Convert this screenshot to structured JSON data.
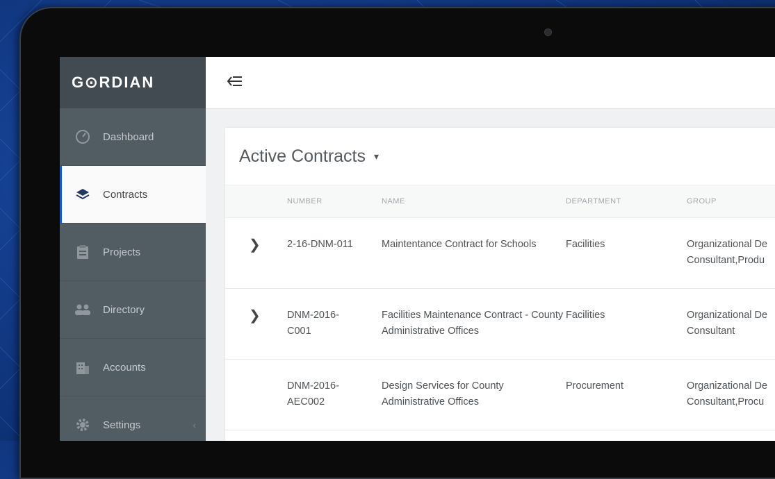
{
  "app": {
    "logo": "G⊙RDIAN"
  },
  "sidebar": {
    "items": [
      {
        "label": "Dashboard",
        "icon": "gauge-icon"
      },
      {
        "label": "Contracts",
        "icon": "layers-icon",
        "active": true
      },
      {
        "label": "Projects",
        "icon": "clipboard-icon"
      },
      {
        "label": "Directory",
        "icon": "people-icon"
      },
      {
        "label": "Accounts",
        "icon": "building-icon"
      },
      {
        "label": "Settings",
        "icon": "gear-icon"
      }
    ]
  },
  "topbar": {
    "toggle_icon": "collapse-menu-icon"
  },
  "main": {
    "title": "Active Contracts",
    "columns": [
      "NUMBER",
      "NAME",
      "DEPARTMENT",
      "GROUP"
    ],
    "rows": [
      {
        "number": "2-16-DNM-011",
        "name": "Maintentance Contract for Schools",
        "department": "Facilities",
        "group_line1": "Organizational De",
        "group_line2": "Consultant,Produ",
        "expandable": true
      },
      {
        "number_line1": "DNM-2016-",
        "number_line2": "C001",
        "name": "Facilities Maintenance Contract - County Administrative Offices",
        "department": "Facilities",
        "group_line1": "Organizational De",
        "group_line2": "Consultant",
        "expandable": true
      },
      {
        "number_line1": "DNM-2016-",
        "number_line2": "AEC002",
        "name": "Design Services for County Administrative Offices",
        "department": "Procurement",
        "group_line1": "Organizational De",
        "group_line2": "Consultant,Procu",
        "expandable": false
      }
    ]
  },
  "colors": {
    "sidebar": "#525c63",
    "sidebar_header": "#424b52",
    "accent": "#1a5bd1",
    "background": "#123a86"
  }
}
